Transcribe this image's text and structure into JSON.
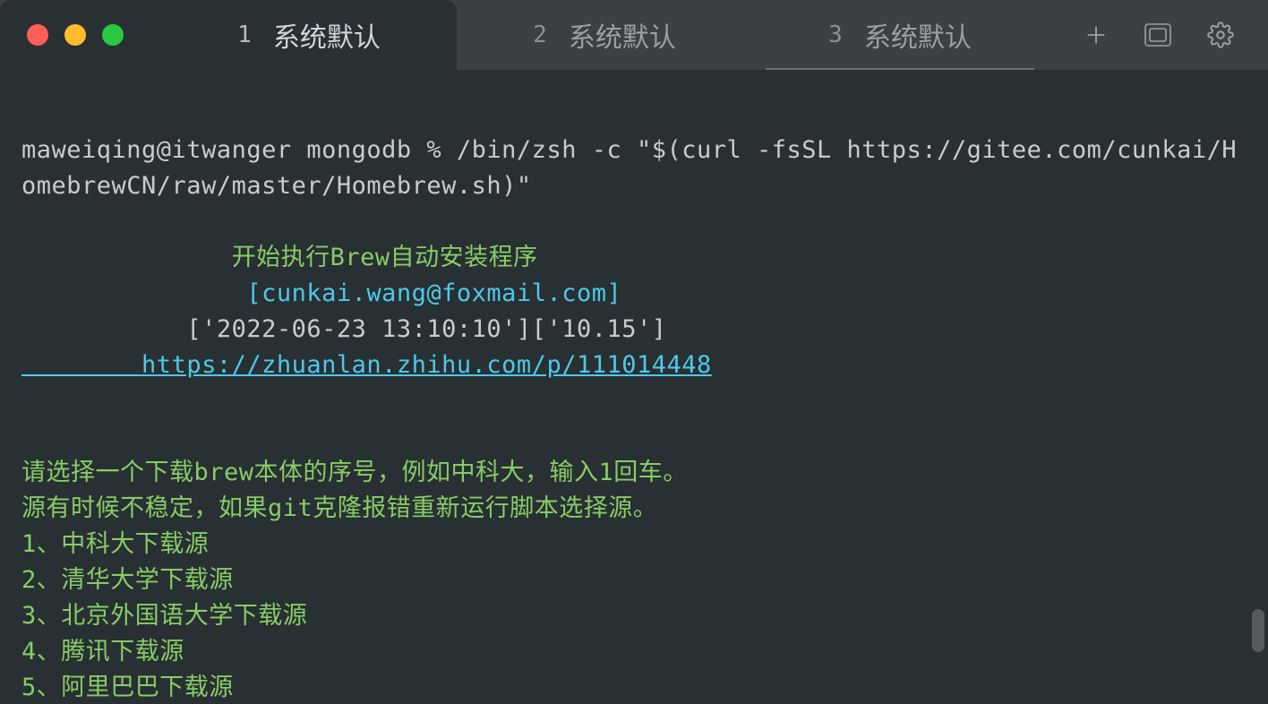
{
  "tabs": [
    {
      "num": "1",
      "title": "系统默认"
    },
    {
      "num": "2",
      "title": "系统默认"
    },
    {
      "num": "3",
      "title": "系统默认"
    }
  ],
  "term": {
    "prompt": "maweiqing@itwanger mongodb % /bin/zsh -c \"$(curl -fsSL https://gitee.com/cunkai/HomebrewCN/raw/master/Homebrew.sh)\"",
    "header1": "              开始执行Brew自动安装程序",
    "header2": "               [cunkai.wang@foxmail.com]",
    "header3": "           ['2022-06-23 13:10:10']['10.15']",
    "header4": "        https://zhuanlan.zhihu.com/p/111014448",
    "prompt_q": "请选择一个下载brew本体的序号，例如中科大，输入1回车。",
    "note": "源有时候不稳定，如果git克隆报错重新运行脚本选择源。",
    "opt1": "1、中科大下载源",
    "opt2": "2、清华大学下载源",
    "opt3": "3、北京外国语大学下载源",
    "opt4": "4、腾讯下载源",
    "opt5": "5、阿里巴巴下载源"
  }
}
